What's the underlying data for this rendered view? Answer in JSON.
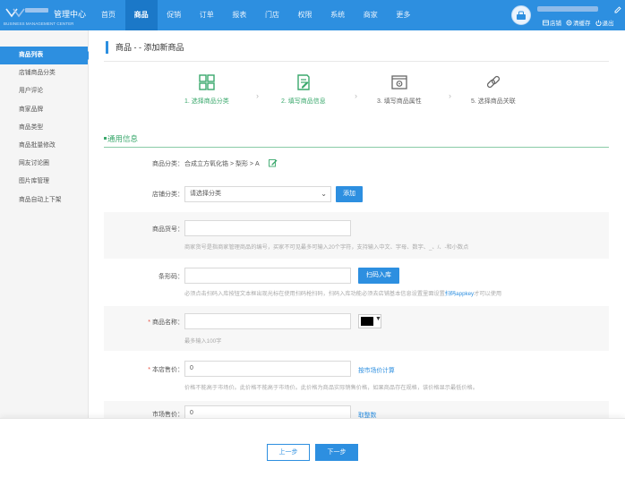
{
  "header": {
    "title": "管理中心",
    "subtitle": "BUSINESS MANAGEMENT CENTER",
    "nav": [
      "首页",
      "商品",
      "促销",
      "订单",
      "报表",
      "门店",
      "权限",
      "系统",
      "商家",
      "更多"
    ],
    "active_nav": "商品",
    "links": {
      "store": "店铺",
      "clear_cache": "清缓存",
      "logout": "退出"
    }
  },
  "sidebar": {
    "items": [
      {
        "label": "商品列表",
        "active": true
      },
      {
        "label": "店铺商品分类"
      },
      {
        "label": "用户评论"
      },
      {
        "label": "商家品牌"
      },
      {
        "label": "商品类型"
      },
      {
        "label": "商品批量修改"
      },
      {
        "label": "网友讨论圈"
      },
      {
        "label": "图片库管理"
      },
      {
        "label": "商品自动上下架"
      }
    ]
  },
  "main": {
    "title": "商品 - - 添加新商品",
    "steps": [
      {
        "label": "1. 选择商品分类",
        "state": "done",
        "icon": "grid-icon"
      },
      {
        "label": "2. 填写商品信息",
        "state": "done",
        "icon": "document-edit-icon"
      },
      {
        "label": "3. 填写商品属性",
        "state": "todo",
        "icon": "window-gear-icon"
      },
      {
        "label": "5. 选择商品关联",
        "state": "todo",
        "icon": "link-icon"
      }
    ],
    "section_title": "通用信息",
    "form": {
      "category": {
        "label": "商品分类：",
        "value": "合成立方氧化锆 > 梨形 > A"
      },
      "store_category": {
        "label": "店铺分类：",
        "placeholder": "请选择分类",
        "button": "添加"
      },
      "sku": {
        "label": "商品货号：",
        "value": "",
        "hint": "商家货号是指商家管理商品的编号，买家不可见最多可输入20个字符，支持输入中文、字母、数字、_、/、-和小数点"
      },
      "barcode": {
        "label": "条形码：",
        "value": "",
        "button": "扫码入库",
        "hint_before": "必须点击扫码入库按钮文本框出现光标在使用扫码枪扫码，扫码入库功能必须去店铺基本信息设置里面设置",
        "hint_link": "扫码appkey",
        "hint_after": "才可以使用"
      },
      "name": {
        "label": "商品名称：",
        "required": true,
        "value": "",
        "hint": "最多输入100字",
        "color": "#000000"
      },
      "price": {
        "label": "本店售价：",
        "required": true,
        "value": "0",
        "link": "按市场价计算",
        "hint": "价格不能高于市场价。此价格不能高于市场价。此价格为商品实际销售价格，如果商品存在规格，该价格显示最低价格。"
      },
      "market_price": {
        "label": "市场售价：",
        "value": "0",
        "link": "取整数"
      }
    }
  },
  "footer": {
    "prev": "上一步",
    "next": "下一步"
  }
}
